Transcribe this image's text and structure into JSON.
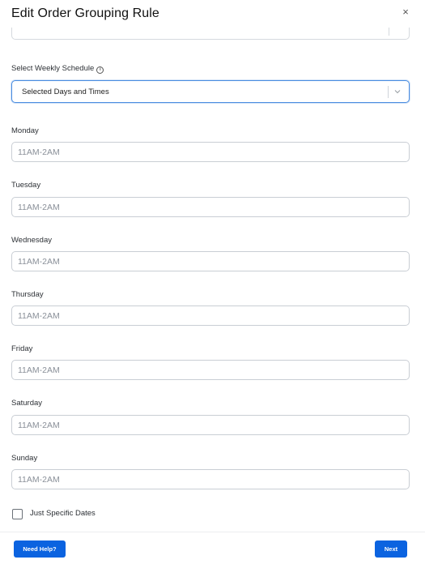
{
  "modal": {
    "title": "Edit Order Grouping Rule",
    "close_glyph": "×"
  },
  "schedule": {
    "label": "Select Weekly Schedule",
    "info_glyph": "i",
    "selected_value": "Selected Days and Times"
  },
  "days": [
    {
      "label": "Monday",
      "value": "",
      "placeholder": "11AM-2AM"
    },
    {
      "label": "Tuesday",
      "value": "",
      "placeholder": "11AM-2AM"
    },
    {
      "label": "Wednesday",
      "value": "",
      "placeholder": "11AM-2AM"
    },
    {
      "label": "Thursday",
      "value": "",
      "placeholder": "11AM-2AM"
    },
    {
      "label": "Friday",
      "value": "",
      "placeholder": "11AM-2AM"
    },
    {
      "label": "Saturday",
      "value": "",
      "placeholder": "11AM-2AM"
    },
    {
      "label": "Sunday",
      "value": "",
      "placeholder": "11AM-2AM"
    }
  ],
  "specific_dates": {
    "label": "Just Specific Dates",
    "checked": false
  },
  "footer": {
    "help_label": "Need Help?",
    "next_label": "Next"
  },
  "colors": {
    "primary_button": "#0b63e0",
    "focus_border": "#4a8de0"
  },
  "icons": {
    "close": "close-icon",
    "info": "info-icon",
    "dropdown": "chevron-down-icon"
  }
}
